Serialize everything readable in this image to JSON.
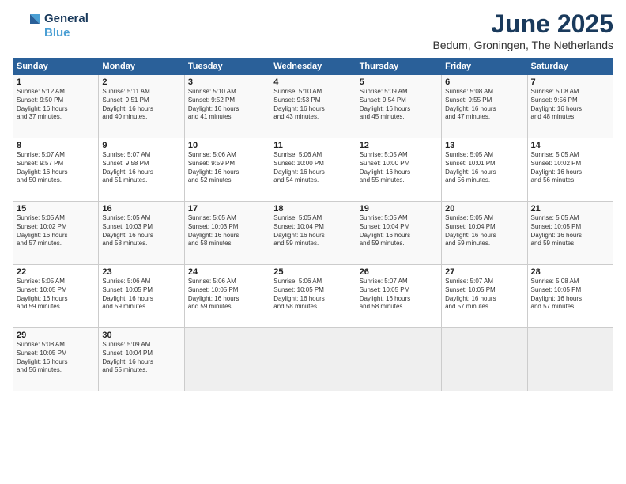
{
  "header": {
    "logo_line1": "General",
    "logo_line2": "Blue",
    "month": "June 2025",
    "location": "Bedum, Groningen, The Netherlands"
  },
  "weekdays": [
    "Sunday",
    "Monday",
    "Tuesday",
    "Wednesday",
    "Thursday",
    "Friday",
    "Saturday"
  ],
  "weeks": [
    [
      {
        "day": "1",
        "info": "Sunrise: 5:12 AM\nSunset: 9:50 PM\nDaylight: 16 hours\nand 37 minutes."
      },
      {
        "day": "2",
        "info": "Sunrise: 5:11 AM\nSunset: 9:51 PM\nDaylight: 16 hours\nand 40 minutes."
      },
      {
        "day": "3",
        "info": "Sunrise: 5:10 AM\nSunset: 9:52 PM\nDaylight: 16 hours\nand 41 minutes."
      },
      {
        "day": "4",
        "info": "Sunrise: 5:10 AM\nSunset: 9:53 PM\nDaylight: 16 hours\nand 43 minutes."
      },
      {
        "day": "5",
        "info": "Sunrise: 5:09 AM\nSunset: 9:54 PM\nDaylight: 16 hours\nand 45 minutes."
      },
      {
        "day": "6",
        "info": "Sunrise: 5:08 AM\nSunset: 9:55 PM\nDaylight: 16 hours\nand 47 minutes."
      },
      {
        "day": "7",
        "info": "Sunrise: 5:08 AM\nSunset: 9:56 PM\nDaylight: 16 hours\nand 48 minutes."
      }
    ],
    [
      {
        "day": "8",
        "info": "Sunrise: 5:07 AM\nSunset: 9:57 PM\nDaylight: 16 hours\nand 50 minutes."
      },
      {
        "day": "9",
        "info": "Sunrise: 5:07 AM\nSunset: 9:58 PM\nDaylight: 16 hours\nand 51 minutes."
      },
      {
        "day": "10",
        "info": "Sunrise: 5:06 AM\nSunset: 9:59 PM\nDaylight: 16 hours\nand 52 minutes."
      },
      {
        "day": "11",
        "info": "Sunrise: 5:06 AM\nSunset: 10:00 PM\nDaylight: 16 hours\nand 54 minutes."
      },
      {
        "day": "12",
        "info": "Sunrise: 5:05 AM\nSunset: 10:00 PM\nDaylight: 16 hours\nand 55 minutes."
      },
      {
        "day": "13",
        "info": "Sunrise: 5:05 AM\nSunset: 10:01 PM\nDaylight: 16 hours\nand 56 minutes."
      },
      {
        "day": "14",
        "info": "Sunrise: 5:05 AM\nSunset: 10:02 PM\nDaylight: 16 hours\nand 56 minutes."
      }
    ],
    [
      {
        "day": "15",
        "info": "Sunrise: 5:05 AM\nSunset: 10:02 PM\nDaylight: 16 hours\nand 57 minutes."
      },
      {
        "day": "16",
        "info": "Sunrise: 5:05 AM\nSunset: 10:03 PM\nDaylight: 16 hours\nand 58 minutes."
      },
      {
        "day": "17",
        "info": "Sunrise: 5:05 AM\nSunset: 10:03 PM\nDaylight: 16 hours\nand 58 minutes."
      },
      {
        "day": "18",
        "info": "Sunrise: 5:05 AM\nSunset: 10:04 PM\nDaylight: 16 hours\nand 59 minutes."
      },
      {
        "day": "19",
        "info": "Sunrise: 5:05 AM\nSunset: 10:04 PM\nDaylight: 16 hours\nand 59 minutes."
      },
      {
        "day": "20",
        "info": "Sunrise: 5:05 AM\nSunset: 10:04 PM\nDaylight: 16 hours\nand 59 minutes."
      },
      {
        "day": "21",
        "info": "Sunrise: 5:05 AM\nSunset: 10:05 PM\nDaylight: 16 hours\nand 59 minutes."
      }
    ],
    [
      {
        "day": "22",
        "info": "Sunrise: 5:05 AM\nSunset: 10:05 PM\nDaylight: 16 hours\nand 59 minutes."
      },
      {
        "day": "23",
        "info": "Sunrise: 5:06 AM\nSunset: 10:05 PM\nDaylight: 16 hours\nand 59 minutes."
      },
      {
        "day": "24",
        "info": "Sunrise: 5:06 AM\nSunset: 10:05 PM\nDaylight: 16 hours\nand 59 minutes."
      },
      {
        "day": "25",
        "info": "Sunrise: 5:06 AM\nSunset: 10:05 PM\nDaylight: 16 hours\nand 58 minutes."
      },
      {
        "day": "26",
        "info": "Sunrise: 5:07 AM\nSunset: 10:05 PM\nDaylight: 16 hours\nand 58 minutes."
      },
      {
        "day": "27",
        "info": "Sunrise: 5:07 AM\nSunset: 10:05 PM\nDaylight: 16 hours\nand 57 minutes."
      },
      {
        "day": "28",
        "info": "Sunrise: 5:08 AM\nSunset: 10:05 PM\nDaylight: 16 hours\nand 57 minutes."
      }
    ],
    [
      {
        "day": "29",
        "info": "Sunrise: 5:08 AM\nSunset: 10:05 PM\nDaylight: 16 hours\nand 56 minutes."
      },
      {
        "day": "30",
        "info": "Sunrise: 5:09 AM\nSunset: 10:04 PM\nDaylight: 16 hours\nand 55 minutes."
      },
      {
        "day": "",
        "info": ""
      },
      {
        "day": "",
        "info": ""
      },
      {
        "day": "",
        "info": ""
      },
      {
        "day": "",
        "info": ""
      },
      {
        "day": "",
        "info": ""
      }
    ]
  ]
}
